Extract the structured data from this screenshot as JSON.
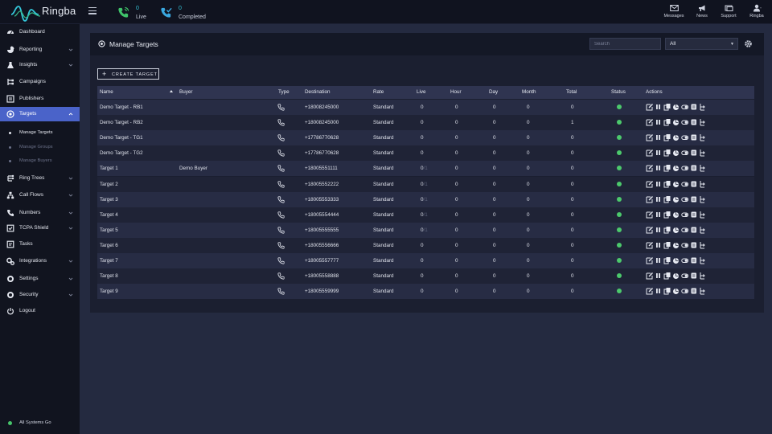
{
  "app": {
    "brand": "Ringba"
  },
  "header": {
    "stats": [
      {
        "value": "0",
        "label": "Live",
        "icon": "phone-live-icon"
      },
      {
        "value": "0",
        "label": "Completed",
        "icon": "phone-completed-icon"
      }
    ],
    "nav": [
      {
        "label": "Messages",
        "icon": "envelope-icon"
      },
      {
        "label": "News",
        "icon": "megaphone-icon"
      },
      {
        "label": "Support",
        "icon": "support-icon"
      },
      {
        "label": "Ringba",
        "icon": "user-icon"
      }
    ]
  },
  "sidebar": {
    "items": [
      {
        "label": "Dashboard",
        "icon": "dashboard-icon",
        "chevron": false
      },
      {
        "label": "Reporting",
        "icon": "chart-icon",
        "chevron": true
      },
      {
        "label": "Insights",
        "icon": "flask-icon",
        "chevron": true
      },
      {
        "label": "Campaigns",
        "icon": "campaigns-icon",
        "chevron": false
      },
      {
        "label": "Publishers",
        "icon": "publishers-icon",
        "chevron": false
      },
      {
        "label": "Targets",
        "icon": "target-icon",
        "chevron": true,
        "active": true
      },
      {
        "label": "Ring Trees",
        "icon": "tree-icon",
        "chevron": true
      },
      {
        "label": "Call Flows",
        "icon": "flows-icon",
        "chevron": true
      },
      {
        "label": "Numbers",
        "icon": "phone-icon",
        "chevron": true
      },
      {
        "label": "TCPA Shield",
        "icon": "shield-icon",
        "chevron": true
      },
      {
        "label": "Tasks",
        "icon": "tasks-icon",
        "chevron": false
      },
      {
        "label": "Integrations",
        "icon": "integrations-icon",
        "chevron": true
      },
      {
        "label": "Settings",
        "icon": "gear-icon",
        "chevron": true
      },
      {
        "label": "Security",
        "icon": "lock-icon",
        "chevron": true
      },
      {
        "label": "Logout",
        "icon": "power-icon",
        "chevron": false
      }
    ],
    "sub_items": [
      {
        "label": "Manage Targets",
        "current": true
      },
      {
        "label": "Manage Groups",
        "current": false
      },
      {
        "label": "Manage Buyers",
        "current": false
      }
    ],
    "system_status": "All Systems Go"
  },
  "panel": {
    "title": "Manage Targets",
    "search_placeholder": "Search",
    "filter_value": "All",
    "create_label": "CREATE TARGET"
  },
  "table": {
    "columns": [
      "Name",
      "Buyer",
      "Type",
      "Destination",
      "Rate",
      "Live",
      "Hour",
      "Day",
      "Month",
      "Total",
      "Status",
      "Actions"
    ],
    "rows": [
      {
        "name": "Demo Target - RB1",
        "buyer": "",
        "destination": "+18008245000",
        "rate": "Standard",
        "live": "0",
        "cap": "",
        "hour": "0",
        "day": "0",
        "month": "0",
        "total": "0"
      },
      {
        "name": "Demo Target - RB2",
        "buyer": "",
        "destination": "+18008245000",
        "rate": "Standard",
        "live": "0",
        "cap": "",
        "hour": "0",
        "day": "0",
        "month": "0",
        "total": "1"
      },
      {
        "name": "Demo Target - TG1",
        "buyer": "",
        "destination": "+17786770628",
        "rate": "Standard",
        "live": "0",
        "cap": "",
        "hour": "0",
        "day": "0",
        "month": "0",
        "total": "0"
      },
      {
        "name": "Demo Target - TG2",
        "buyer": "",
        "destination": "+17786770628",
        "rate": "Standard",
        "live": "0",
        "cap": "",
        "hour": "0",
        "day": "0",
        "month": "0",
        "total": "0"
      },
      {
        "name": "Target 1",
        "buyer": "Demo Buyer",
        "destination": "+18005551111",
        "rate": "Standard",
        "live": "0",
        "cap": "/1",
        "hour": "0",
        "day": "0",
        "month": "0",
        "total": "0"
      },
      {
        "name": "Target 2",
        "buyer": "",
        "destination": "+18005552222",
        "rate": "Standard",
        "live": "0",
        "cap": "/1",
        "hour": "0",
        "day": "0",
        "month": "0",
        "total": "0"
      },
      {
        "name": "Target 3",
        "buyer": "",
        "destination": "+18005553333",
        "rate": "Standard",
        "live": "0",
        "cap": "/1",
        "hour": "0",
        "day": "0",
        "month": "0",
        "total": "0"
      },
      {
        "name": "Target 4",
        "buyer": "",
        "destination": "+18005554444",
        "rate": "Standard",
        "live": "0",
        "cap": "/1",
        "hour": "0",
        "day": "0",
        "month": "0",
        "total": "0"
      },
      {
        "name": "Target 5",
        "buyer": "",
        "destination": "+18005555555",
        "rate": "Standard",
        "live": "0",
        "cap": "/1",
        "hour": "0",
        "day": "0",
        "month": "0",
        "total": "0"
      },
      {
        "name": "Target 6",
        "buyer": "",
        "destination": "+18005556666",
        "rate": "Standard",
        "live": "0",
        "cap": "",
        "hour": "0",
        "day": "0",
        "month": "0",
        "total": "0"
      },
      {
        "name": "Target 7",
        "buyer": "",
        "destination": "+18005557777",
        "rate": "Standard",
        "live": "0",
        "cap": "",
        "hour": "0",
        "day": "0",
        "month": "0",
        "total": "0"
      },
      {
        "name": "Target 8",
        "buyer": "",
        "destination": "+18005558888",
        "rate": "Standard",
        "live": "0",
        "cap": "",
        "hour": "0",
        "day": "0",
        "month": "0",
        "total": "0"
      },
      {
        "name": "Target 9",
        "buyer": "",
        "destination": "+18005559999",
        "rate": "Standard",
        "live": "0",
        "cap": "",
        "hour": "0",
        "day": "0",
        "month": "0",
        "total": "0"
      }
    ],
    "action_icons": [
      "edit-icon",
      "pause-icon",
      "copy-icon",
      "stats-icon",
      "toggle-icon",
      "archive-icon",
      "routing-icon"
    ],
    "status_color": "#4cc96c"
  },
  "colors": {
    "accent": "#4a63c9",
    "live": "#34c5d8",
    "ok": "#46c46a"
  }
}
